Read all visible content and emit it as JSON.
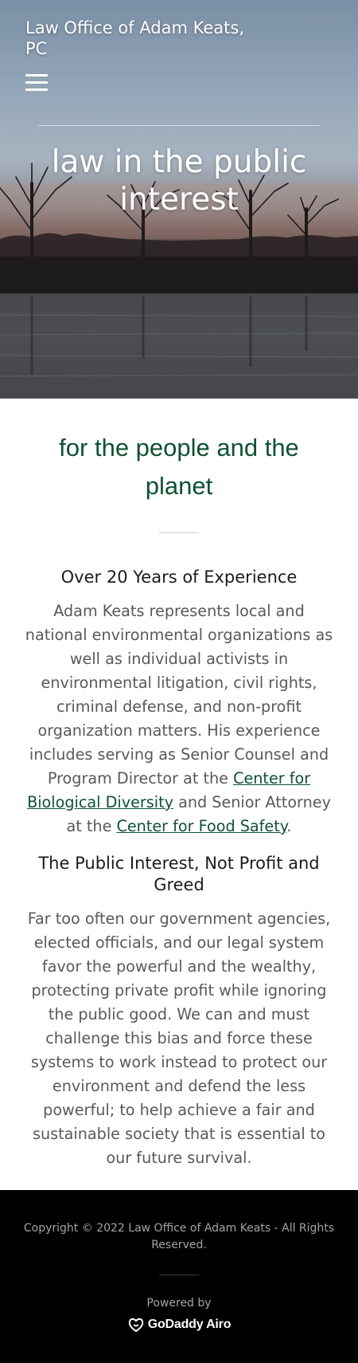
{
  "header": {
    "site_title": "Law Office of Adam Keats, PC",
    "menu_icon": "hamburger-menu-icon",
    "tagline": "law in the public interest"
  },
  "main": {
    "heading": "for the people and the planet",
    "sections": [
      {
        "title": "Over 20 Years of Experience",
        "text_before_link1": "Adam Keats represents local and national environmental organizations as well as individual activists in environmental litigation, civil rights, criminal defense, and non-profit organization matters. His experience includes serving as Senior Counsel and Program Director at the ",
        "link1": "Center for Biological Diversity",
        "text_between_links": " and Senior Attorney at the ",
        "link2": "Center for Food Safety",
        "text_after_link2": "."
      },
      {
        "title": "The Public Interest, Not Profit and Greed",
        "text": "Far too often our government agencies, elected officials, and our legal system favor the powerful and the wealthy, protecting private profit while ignoring the public good. We can and must challenge this bias and force these systems to work instead to protect our environment and defend the less powerful; to help achieve a fair and sustainable society that is essential to our future survival."
      }
    ]
  },
  "footer": {
    "copyright": "Copyright © 2022 Law Office of Adam Keats - All Rights Reserved.",
    "powered_by": "Powered by",
    "brand": "GoDaddy Airo",
    "brand_icon": "godaddy-logo-icon"
  },
  "colors": {
    "accent_green": "#0f5132",
    "body_text": "#595959",
    "footer_bg": "#000000"
  }
}
